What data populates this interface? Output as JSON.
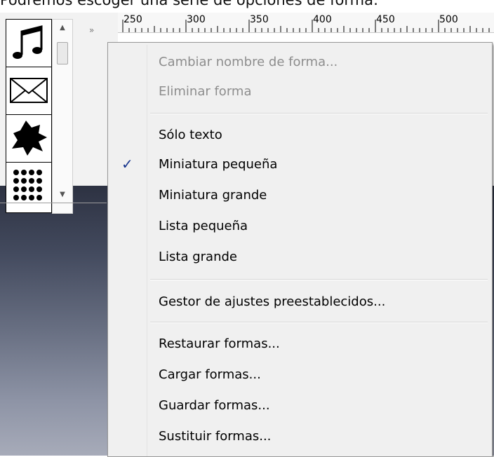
{
  "caption": "Podremos escoger una serie de opciones de forma:",
  "ruler": {
    "labels": [
      "250",
      "300",
      "350",
      "400",
      "450",
      "500"
    ]
  },
  "shape_panel": {
    "expand_label": "»",
    "shapes": [
      {
        "icon": "music-note-icon"
      },
      {
        "icon": "envelope-icon"
      },
      {
        "icon": "splat-icon"
      },
      {
        "icon": "dot-grid-icon"
      }
    ]
  },
  "menu": {
    "items": [
      {
        "label": "Cambiar nombre de forma...",
        "disabled": true
      },
      {
        "label": "Eliminar forma",
        "disabled": true
      },
      {
        "label": "Sólo texto"
      },
      {
        "label": "Miniatura pequeña",
        "checked": true
      },
      {
        "label": "Miniatura grande"
      },
      {
        "label": "Lista pequeña"
      },
      {
        "label": "Lista grande"
      },
      {
        "label": "Gestor de ajustes preestablecidos..."
      },
      {
        "label": "Restaurar formas..."
      },
      {
        "label": "Cargar formas..."
      },
      {
        "label": "Guardar formas..."
      },
      {
        "label": "Sustituir formas..."
      }
    ],
    "check_glyph": "✓"
  }
}
